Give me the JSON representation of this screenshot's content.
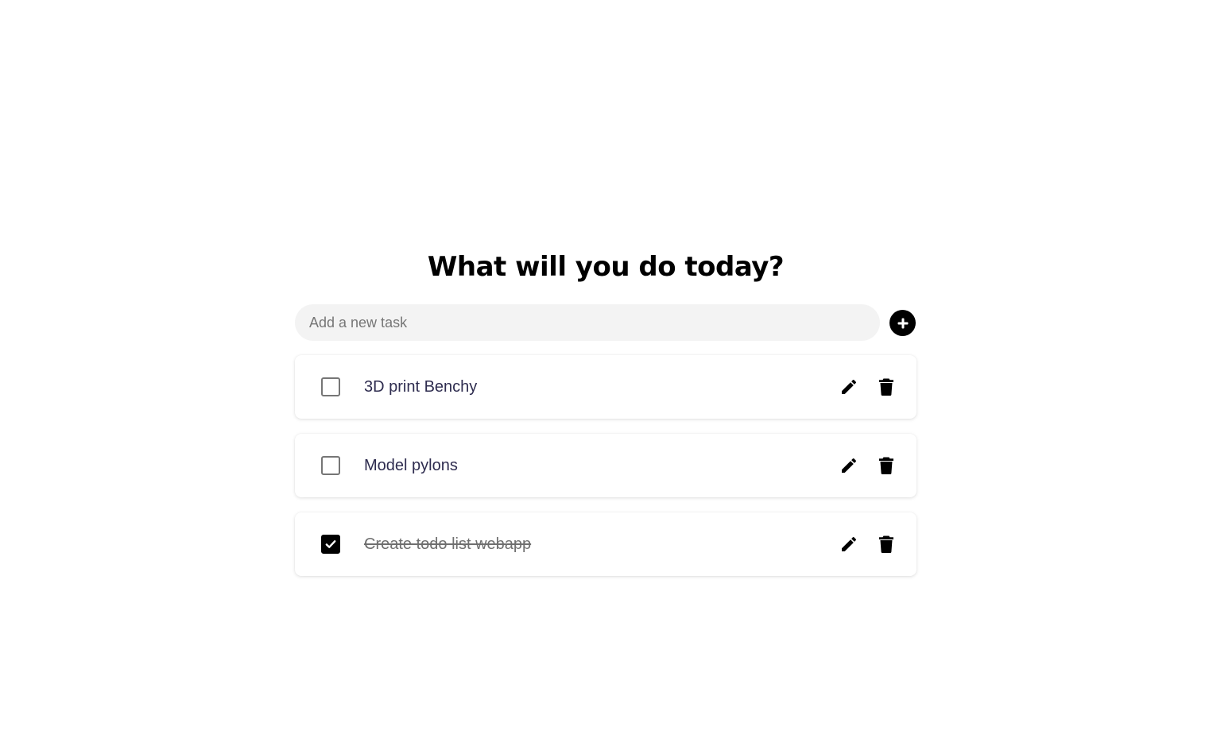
{
  "header": {
    "title": "What will you do today?"
  },
  "new_task": {
    "placeholder": "Add a new task",
    "value": "",
    "add_icon": "plus-circle-icon"
  },
  "tasks": [
    {
      "label": "3D print Benchy",
      "completed": false,
      "edit_icon": "pencil-icon",
      "delete_icon": "trash-icon"
    },
    {
      "label": "Model pylons",
      "completed": false,
      "edit_icon": "pencil-icon",
      "delete_icon": "trash-icon"
    },
    {
      "label": "Create todo list webapp",
      "completed": true,
      "edit_icon": "pencil-icon",
      "delete_icon": "trash-icon"
    }
  ],
  "colors": {
    "background": "#ffffff",
    "title": "#000000",
    "input_background": "#f3f3f3",
    "task_text": "#2e2c4f",
    "completed_text": "#6f6f6f",
    "accent": "#000000"
  }
}
